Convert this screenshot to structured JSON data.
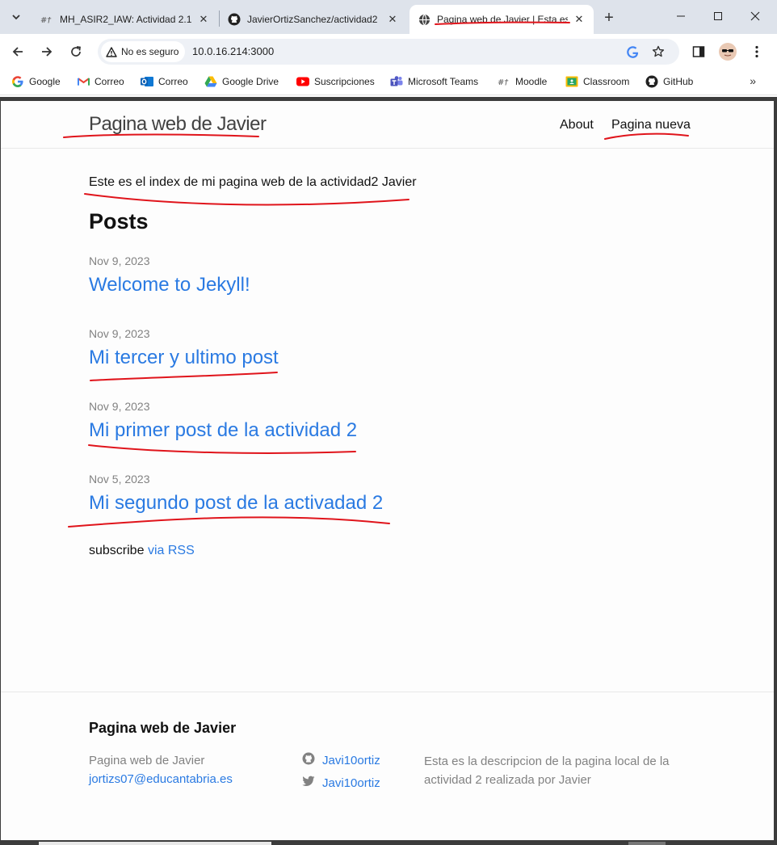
{
  "browser": {
    "tabs": [
      {
        "title": "MH_ASIR2_IAW: Actividad 2.1",
        "icon": "moodle-icon",
        "active": false
      },
      {
        "title": "JavierOrtizSanchez/actividad2",
        "icon": "github-icon",
        "active": false
      },
      {
        "title": "Pagina web de Javier | Esta es",
        "icon": "globe-icon",
        "active": true
      }
    ],
    "security_label": "No es seguro",
    "url": "10.0.16.214:3000",
    "bookmarks": [
      {
        "label": "Google",
        "icon": "google-icon"
      },
      {
        "label": "Correo",
        "icon": "gmail-icon"
      },
      {
        "label": "Correo",
        "icon": "outlook-icon"
      },
      {
        "label": "Google Drive",
        "icon": "drive-icon"
      },
      {
        "label": "Suscripciones",
        "icon": "youtube-icon"
      },
      {
        "label": "Microsoft Teams",
        "icon": "teams-icon"
      },
      {
        "label": "Moodle",
        "icon": "moodle-icon"
      },
      {
        "label": "Classroom",
        "icon": "classroom-icon"
      },
      {
        "label": "GitHub",
        "icon": "github-icon"
      }
    ],
    "more_bookmarks": "»"
  },
  "site": {
    "title": "Pagina web de Javier",
    "nav": [
      "About",
      "Pagina nueva"
    ]
  },
  "main": {
    "intro": "Este es el index de mi pagina web de la actividad2 Javier",
    "posts_heading": "Posts",
    "posts": [
      {
        "date": "Nov 9, 2023",
        "title": "Welcome to Jekyll!"
      },
      {
        "date": "Nov 9, 2023",
        "title": "Mi tercer y ultimo post"
      },
      {
        "date": "Nov 9, 2023",
        "title": "Mi primer post de la actividad 2"
      },
      {
        "date": "Nov 5, 2023",
        "title": "Mi segundo post de la activadad 2"
      }
    ],
    "subscribe_text": "subscribe",
    "subscribe_link": "via RSS"
  },
  "footer": {
    "heading": "Pagina web de Javier",
    "name": "Pagina web de Javier",
    "email": "jortizs07@educantabria.es",
    "github_user": "Javi10ortiz",
    "twitter_user": "Javi10ortiz",
    "description": "Esta es la descripcion de la pagina local de la actividad 2 realizada por Javier"
  },
  "colors": {
    "link": "#2a7ae2",
    "muted": "#828282",
    "annotation": "#e0141b",
    "tabstrip": "#dee3eb"
  }
}
